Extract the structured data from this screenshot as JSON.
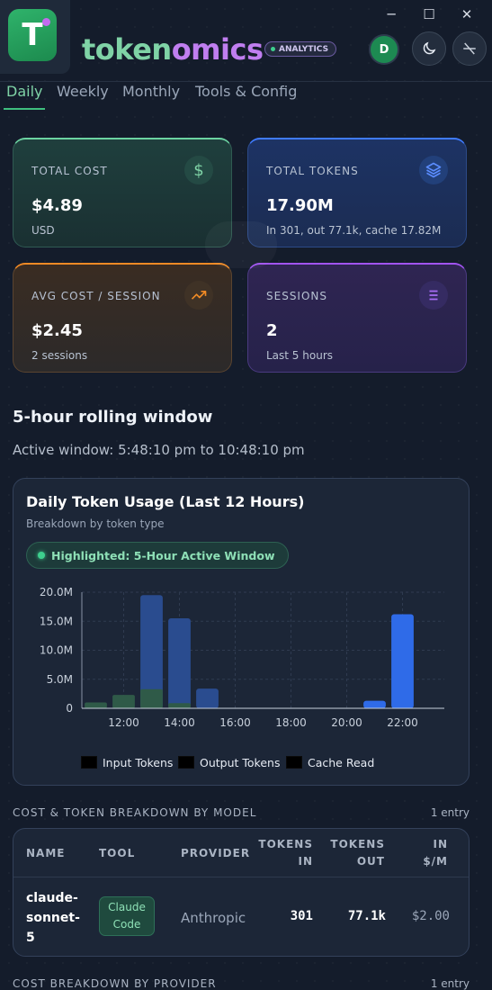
{
  "app": {
    "logo_letter": "T",
    "brand_part1": "token",
    "brand_part2": "omics",
    "badge": "ANALYTICS",
    "avatar_letter": "D"
  },
  "window_controls": {
    "minimize": "─",
    "maximize": "☐",
    "close": "✕"
  },
  "tabs": [
    {
      "label": "Daily",
      "active": true
    },
    {
      "label": "Weekly",
      "active": false
    },
    {
      "label": "Monthly",
      "active": false
    },
    {
      "label": "Tools & Config",
      "active": false
    }
  ],
  "cards": [
    {
      "label": "TOTAL COST",
      "value": "$4.89",
      "sub": "USD",
      "icon": "dollar-icon",
      "icon_glyph": "$",
      "accent": "#6cd3a1"
    },
    {
      "label": "TOTAL TOKENS",
      "value": "17.90M",
      "sub": "In 301, out 77.1k, cache 17.82M",
      "icon": "layers-icon",
      "accent": "#3f7bff"
    },
    {
      "label": "AVG COST / SESSION",
      "value": "$2.45",
      "sub": "2 sessions",
      "icon": "trending-up-icon",
      "accent": "#f08a25"
    },
    {
      "label": "SESSIONS",
      "value": "2",
      "sub": "Last 5 hours",
      "icon": "list-icon",
      "accent": "#a154f2"
    }
  ],
  "window_section": {
    "title": "5-hour rolling window",
    "active_window": "Active window: 5:48:10 pm to 10:48:10 pm"
  },
  "chart_panel": {
    "title": "Daily Token Usage (Last 12 Hours)",
    "subtitle": "Breakdown by token type",
    "highlight_pill": "Highlighted: 5-Hour Active Window"
  },
  "chart_data": {
    "type": "bar",
    "x_ticks": [
      "12:00",
      "14:00",
      "16:00",
      "18:00",
      "20:00",
      "22:00"
    ],
    "y_ticks": [
      "0",
      "5.0M",
      "10.0M",
      "15.0M",
      "20.0M"
    ],
    "ylim": [
      0,
      20000000
    ],
    "xlim": [
      10.5,
      23.5
    ],
    "legend": [
      "Input Tokens",
      "Output Tokens",
      "Cache Read"
    ],
    "bars": [
      {
        "x": 11,
        "cache": 0,
        "output": 1000000
      },
      {
        "x": 12,
        "cache": 0,
        "output": 2300000
      },
      {
        "x": 13,
        "cache": 19500000,
        "output": 3300000
      },
      {
        "x": 14,
        "cache": 15500000,
        "output": 900000
      },
      {
        "x": 15,
        "cache": 3400000,
        "output": 0
      },
      {
        "x": 21,
        "cache": 1300000,
        "output": 0,
        "active": true
      },
      {
        "x": 22,
        "cache": 16200000,
        "output": 0,
        "active": true
      }
    ],
    "colors": {
      "cache": "#2a4c8f",
      "output": "#2f5a48",
      "cache_active": "#2f6be8",
      "output_active": "#2fa36a"
    }
  },
  "breakdown_model": {
    "title": "COST & TOKEN BREAKDOWN BY MODEL",
    "count": "1 entry",
    "headers": {
      "name": "NAME",
      "tool": "TOOL",
      "provider": "PROVIDER",
      "tokens_in_1": "TOKENS",
      "tokens_in_2": "IN",
      "tokens_out_1": "TOKENS",
      "tokens_out_2": "OUT",
      "in_price_1": "IN",
      "in_price_2": "$/M"
    },
    "rows": [
      {
        "name_1": "claude-",
        "name_2": "sonnet-",
        "name_3": "5",
        "tool_1": "Claude",
        "tool_2": "Code",
        "provider": "Anthropic",
        "tokens_in": "301",
        "tokens_out": "77.1k",
        "in_price": "$2.00"
      }
    ]
  },
  "breakdown_provider": {
    "title": "COST BREAKDOWN BY PROVIDER",
    "count": "1 entry"
  }
}
